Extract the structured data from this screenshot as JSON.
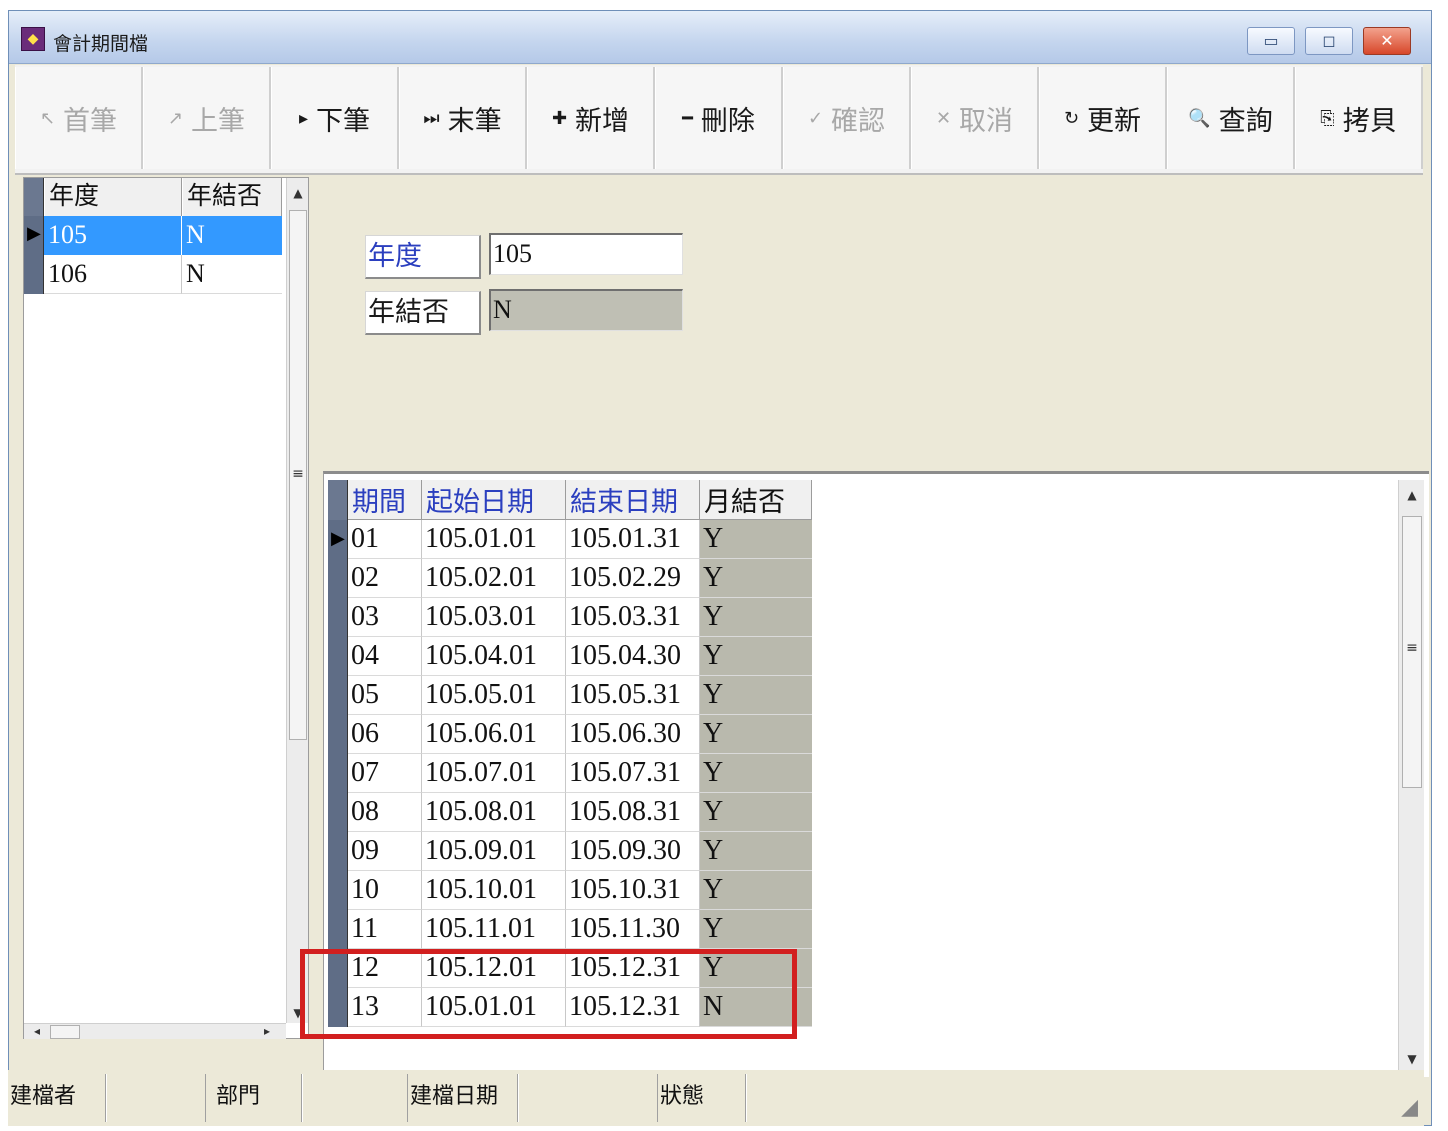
{
  "window": {
    "title": "會計期間檔",
    "icon": "app-icon"
  },
  "toolbar": {
    "buttons": [
      {
        "label": "首筆",
        "icon": "first-record-icon",
        "glyph": "↖",
        "enabled": false
      },
      {
        "label": "上筆",
        "icon": "prev-record-icon",
        "glyph": "↗",
        "enabled": false
      },
      {
        "label": "下筆",
        "icon": "next-record-icon",
        "glyph": "▸",
        "enabled": true
      },
      {
        "label": "末筆",
        "icon": "last-record-icon",
        "glyph": "⏭",
        "enabled": true
      },
      {
        "label": "新增",
        "icon": "add-icon",
        "glyph": "✚",
        "enabled": true
      },
      {
        "label": "刪除",
        "icon": "delete-icon",
        "glyph": "━",
        "enabled": true
      },
      {
        "label": "確認",
        "icon": "confirm-icon",
        "glyph": "✓",
        "enabled": false
      },
      {
        "label": "取消",
        "icon": "cancel-icon",
        "glyph": "✕",
        "enabled": false
      },
      {
        "label": "更新",
        "icon": "refresh-icon",
        "glyph": "↻",
        "enabled": true
      },
      {
        "label": "查詢",
        "icon": "search-icon",
        "glyph": "🔍",
        "enabled": true
      },
      {
        "label": "拷貝",
        "icon": "copy-icon",
        "glyph": "⎘",
        "enabled": true
      }
    ]
  },
  "year_grid": {
    "columns": [
      "年度",
      "年結否"
    ],
    "rows": [
      {
        "year": "105",
        "closed": "N",
        "selected": true
      },
      {
        "year": "106",
        "closed": "N",
        "selected": false
      }
    ]
  },
  "form": {
    "year_label": "年度",
    "year_value": "105",
    "closed_label": "年結否",
    "closed_value": "N"
  },
  "period_grid": {
    "columns": [
      "期間",
      "起始日期",
      "結束日期",
      "月結否"
    ],
    "rows": [
      {
        "period": "01",
        "start": "105.01.01",
        "end": "105.01.31",
        "closed": "Y"
      },
      {
        "period": "02",
        "start": "105.02.01",
        "end": "105.02.29",
        "closed": "Y"
      },
      {
        "period": "03",
        "start": "105.03.01",
        "end": "105.03.31",
        "closed": "Y"
      },
      {
        "period": "04",
        "start": "105.04.01",
        "end": "105.04.30",
        "closed": "Y"
      },
      {
        "period": "05",
        "start": "105.05.01",
        "end": "105.05.31",
        "closed": "Y"
      },
      {
        "period": "06",
        "start": "105.06.01",
        "end": "105.06.30",
        "closed": "Y"
      },
      {
        "period": "07",
        "start": "105.07.01",
        "end": "105.07.31",
        "closed": "Y"
      },
      {
        "period": "08",
        "start": "105.08.01",
        "end": "105.08.31",
        "closed": "Y"
      },
      {
        "period": "09",
        "start": "105.09.01",
        "end": "105.09.30",
        "closed": "Y"
      },
      {
        "period": "10",
        "start": "105.10.01",
        "end": "105.10.31",
        "closed": "Y"
      },
      {
        "period": "11",
        "start": "105.11.01",
        "end": "105.11.30",
        "closed": "Y"
      },
      {
        "period": "12",
        "start": "105.12.01",
        "end": "105.12.31",
        "closed": "Y"
      },
      {
        "period": "13",
        "start": "105.01.01",
        "end": "105.12.31",
        "closed": "N"
      }
    ]
  },
  "status_bar": {
    "creator_label": "建檔者",
    "creator_value": "",
    "dept_label": "部門",
    "dept_value": "",
    "created_date_label": "建檔日期",
    "created_date_value": "",
    "status_label": "狀態",
    "status_value": ""
  },
  "colors": {
    "highlight_row": "#3399ff",
    "highlight_annotation": "#d21f1f",
    "label_blue": "#2b3fbf",
    "readonly_fill": "#b9b9ad"
  }
}
